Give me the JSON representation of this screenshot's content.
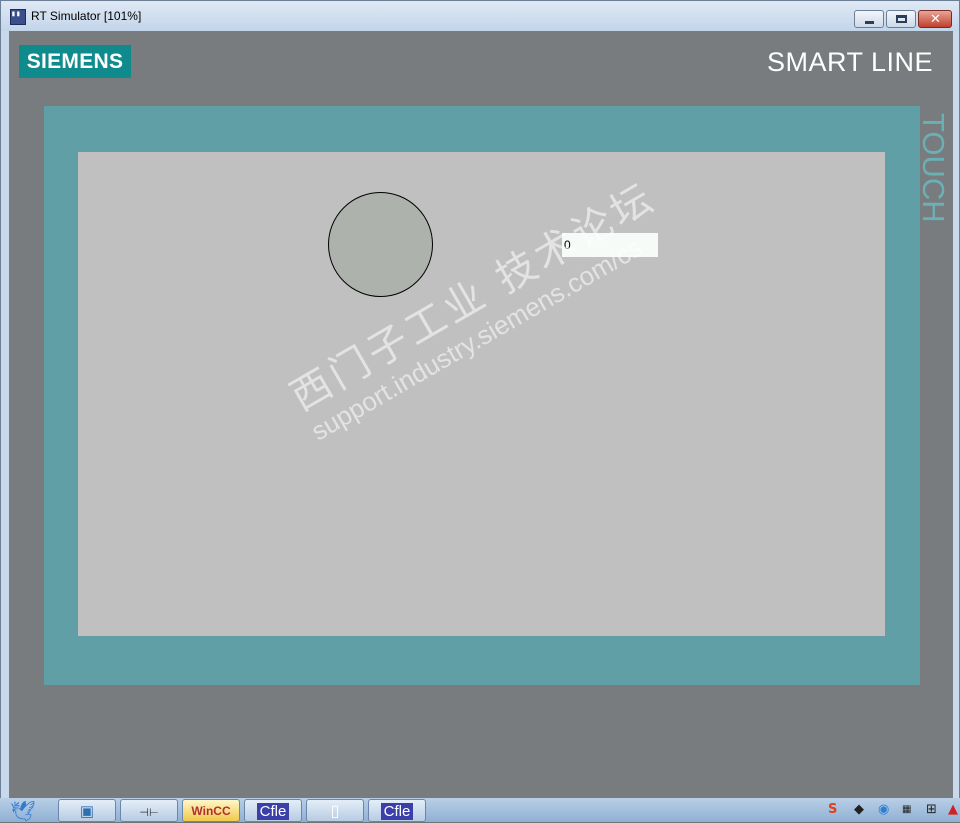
{
  "window": {
    "title": "RT Simulator [101%]",
    "icon": "app-icon",
    "controls": [
      "minimize",
      "restore",
      "close"
    ]
  },
  "device": {
    "brand": "SIEMENS",
    "product_line": "SMART LINE",
    "side_label": "TOUCH"
  },
  "screen": {
    "indicator_color": "#adb2ad",
    "io_field_value": "0"
  },
  "watermark": {
    "line1": "西门子工业 技术论坛",
    "line2": "support.industry.siemens.com/cs"
  },
  "taskbar": {
    "buttons": [
      {
        "label": "",
        "icon": "start-bird-icon"
      },
      {
        "label": "",
        "icon": "explorer-icon"
      },
      {
        "label": "",
        "icon": "ladder-editor-icon"
      },
      {
        "label": "WinCC",
        "icon": "wincc-icon"
      },
      {
        "label": "Cfle",
        "icon": "wincc-flexible-icon"
      },
      {
        "label": "",
        "icon": "document-icon"
      },
      {
        "label": "Cfle",
        "icon": "wincc-flexible-icon"
      }
    ],
    "tray": [
      "S",
      "tray-icon",
      "tray-icon",
      "tray-icon",
      "tray-icon"
    ]
  }
}
